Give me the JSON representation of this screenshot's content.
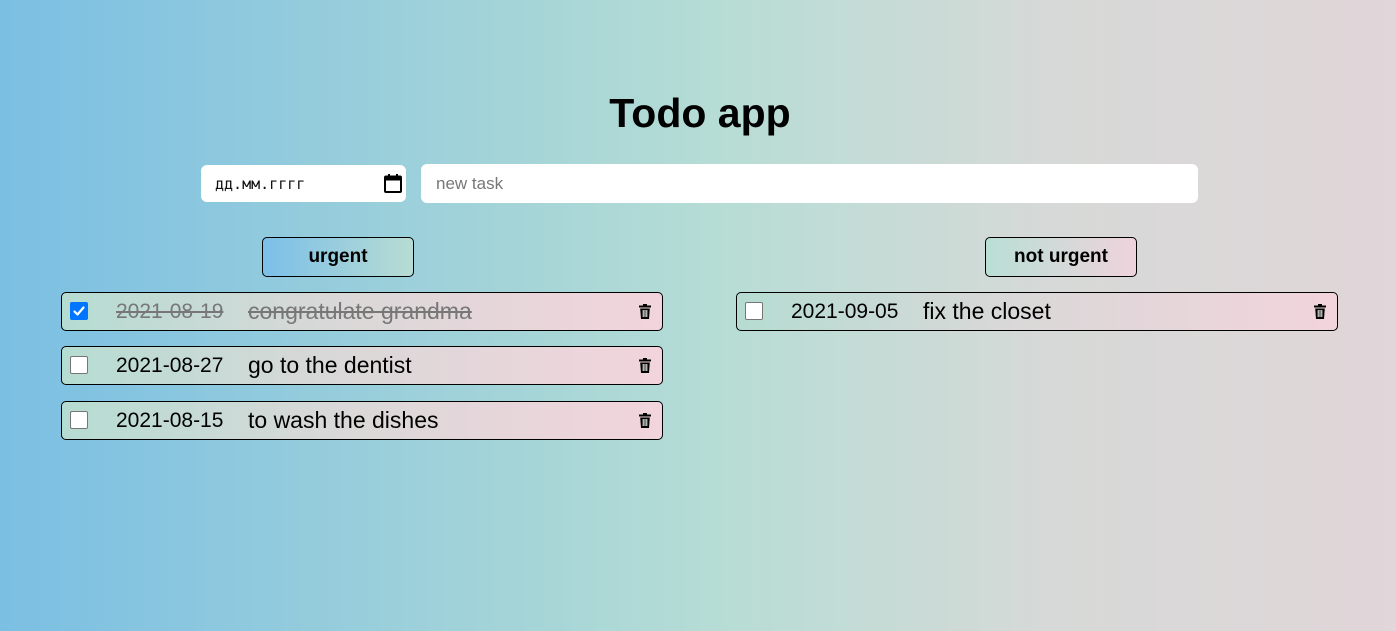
{
  "header": {
    "title": "Todo app"
  },
  "form": {
    "date_placeholder": "дд.мм.гггг",
    "task_placeholder": "new task"
  },
  "columns": {
    "urgent_label": "urgent",
    "not_urgent_label": "not urgent"
  },
  "urgent_tasks": [
    {
      "done": true,
      "date": "2021-08-19",
      "text": "congratulate grandma"
    },
    {
      "done": false,
      "date": "2021-08-27",
      "text": "go to the dentist"
    },
    {
      "done": false,
      "date": "2021-08-15",
      "text": "to wash the dishes"
    }
  ],
  "not_urgent_tasks": [
    {
      "done": false,
      "date": "2021-09-05",
      "text": "fix the closet"
    }
  ],
  "icons": {
    "calendar": "calendar-icon",
    "delete": "trash-icon",
    "check": "checkmark-icon"
  },
  "colors": {
    "checkbox_checked": "#0075ff",
    "done_text": "#777777"
  }
}
